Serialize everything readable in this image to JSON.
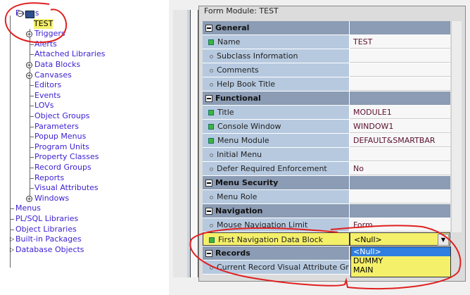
{
  "tree": {
    "root": "Forms",
    "module": "TEST",
    "children": [
      "Triggers",
      "Alerts",
      "Attached Libraries",
      "Data Blocks",
      "Canvases",
      "Editors",
      "Events",
      "LOVs",
      "Object Groups",
      "Parameters",
      "Popup Menus",
      "Program Units",
      "Property Classes",
      "Record Groups",
      "Reports",
      "Visual Attributes",
      "Windows"
    ],
    "expandable_children": [
      "Triggers",
      "Data Blocks",
      "Canvases",
      "Windows"
    ],
    "top_level": [
      "Menus",
      "PL/SQL Libraries",
      "Object Libraries",
      "Built-in Packages",
      "Database Objects"
    ]
  },
  "palette": {
    "title": "Form Module: TEST",
    "rows": [
      {
        "type": "section",
        "label": "General"
      },
      {
        "type": "prop",
        "marker": "green",
        "label": "Name",
        "value": "TEST"
      },
      {
        "type": "prop",
        "marker": "dot",
        "label": "Subclass Information",
        "value": ""
      },
      {
        "type": "prop",
        "marker": "dot",
        "label": "Comments",
        "value": ""
      },
      {
        "type": "prop",
        "marker": "dot",
        "label": "Help Book Title",
        "value": ""
      },
      {
        "type": "section",
        "label": "Functional"
      },
      {
        "type": "prop",
        "marker": "green",
        "label": "Title",
        "value": "MODULE1"
      },
      {
        "type": "prop",
        "marker": "green",
        "label": "Console Window",
        "value": "WINDOW1"
      },
      {
        "type": "prop",
        "marker": "green",
        "label": "Menu Module",
        "value": "DEFAULT&SMARTBAR"
      },
      {
        "type": "prop",
        "marker": "dot",
        "label": "Initial Menu",
        "value": ""
      },
      {
        "type": "prop",
        "marker": "dot",
        "label": "Defer Required Enforcement",
        "value": "No"
      },
      {
        "type": "section",
        "label": "Menu Security"
      },
      {
        "type": "prop",
        "marker": "dot",
        "label": "Menu Role",
        "value": ""
      },
      {
        "type": "section",
        "label": "Navigation"
      },
      {
        "type": "prop",
        "marker": "dot",
        "label": "Mouse Navigation Limit",
        "value": "Form"
      },
      {
        "type": "prop",
        "marker": "green",
        "label": "First Navigation Data Block",
        "value": "<Null>",
        "highlight": true
      },
      {
        "type": "section",
        "label": "Records"
      },
      {
        "type": "prop",
        "marker": "dot",
        "label": "Current Record Visual Attribute Group",
        "value": ""
      }
    ],
    "dropdown_options": [
      "<Null>",
      "DUMMY",
      "MAIN"
    ],
    "dropdown_selected": "<Null>"
  },
  "colors": {
    "highlight": "#f5f06a",
    "annotation": "#e02020",
    "link": "#3a1fd0"
  }
}
